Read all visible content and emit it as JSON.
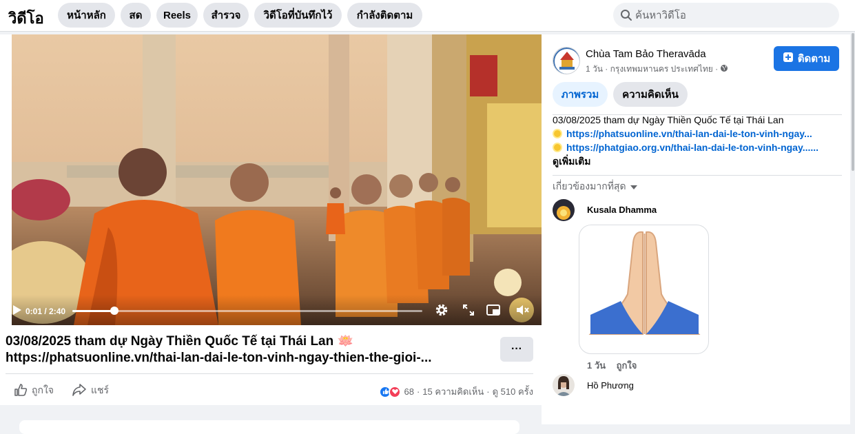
{
  "header": {
    "title": "วิดีโอ",
    "tabs": [
      {
        "label": "หน้าหลัก"
      },
      {
        "label": "สด"
      },
      {
        "label": "Reels"
      },
      {
        "label": "สำรวจ"
      },
      {
        "label": "วิดีโอที่บันทึกไว้"
      },
      {
        "label": "กำลังติดตาม"
      }
    ],
    "search": {
      "placeholder": "ค้นหาวิดีโอ",
      "icon": "search-icon"
    }
  },
  "video": {
    "time": "0:01 / 2:40",
    "progress_fraction": 0.12
  },
  "post": {
    "title_line1": "03/08/2025 tham dự Ngày Thiền Quốc Tế tại Thái Lan 🪷",
    "title_line2": "https://phatsuonline.vn/thai-lan-dai-le-ton-vinh-ngay-thien-the-gioi-...",
    "more_label": "···",
    "like_label": "ถูกใจ",
    "share_label": "แชร์",
    "reaction_count": "68",
    "comments": "15 ความคิดเห็น",
    "views": "ดู 510 ครั้ง",
    "separator": "·"
  },
  "page": {
    "name": "Chùa Tam Bảo Theravāda",
    "meta": "1 วัน · กรุงเทพมหานคร ประเทศไทย ·",
    "follow_label": "ติดตาม",
    "tabs": [
      {
        "label": "ภาพรวม"
      },
      {
        "label": "ความคิดเห็น"
      }
    ],
    "description": {
      "line1": "03/08/2025 tham dự Ngày Thiền Quốc Tế tại Thái Lan",
      "link1": "https://phatsuonline.vn/thai-lan-dai-le-ton-vinh-ngay...",
      "link2": "https://phatgiao.org.vn/thai-lan-dai-le-ton-vinh-ngay......",
      "see_more": "ดูเพิ่มเติม"
    },
    "relevant_label": "เกี่ยวข้องมากที่สุด"
  },
  "comments": [
    {
      "name": "Kusala Dhamma",
      "time": "1 วัน",
      "like": "ถูกใจ"
    },
    {
      "name": "Hồ Phương"
    }
  ],
  "colors": {
    "accent": "#1b74e4",
    "link": "#0064d1",
    "tab_active_bg": "#e7f3ff"
  }
}
